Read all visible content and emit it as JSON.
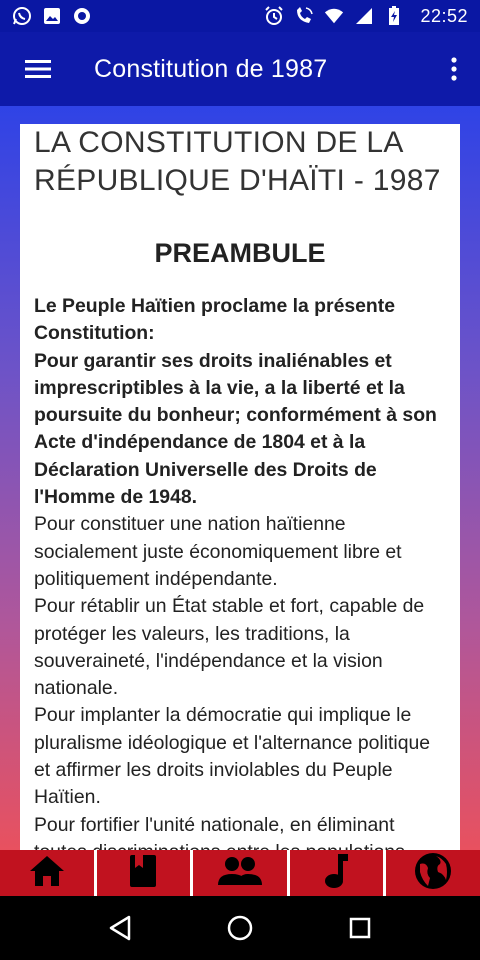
{
  "status_bar": {
    "time": "22:52",
    "left_icons": [
      "whatsapp-icon",
      "image-icon",
      "circle-app-icon"
    ],
    "right_icons": [
      "alarm-icon",
      "wifi-call-icon",
      "wifi-icon",
      "signal-icon",
      "battery-charging-icon"
    ]
  },
  "app_bar": {
    "title": "Constitution de 1987",
    "menu_icon": "hamburger-menu-icon",
    "more_icon": "more-vert-icon"
  },
  "document": {
    "title": "LA CONSTITUTION DE LA RÉPUBLIQUE D'HAÏTI - 1987",
    "heading": "PREAMBULE",
    "bold_intro": "Le Peuple Haïtien proclame la présente Constitution:",
    "bold_para": "Pour garantir ses droits inaliénables et imprescriptibles à la vie, a la liberté et la poursuite du bonheur; conformément à son Acte d'indépendance de 1804 et à la Déclaration Universelle des Droits de l'Homme de 1948.",
    "paragraphs": [
      "Pour constituer une nation haïtienne socialement juste économiquement libre et politiquement indépendante.",
      "Pour rétablir un État stable et fort, capable de protéger les valeurs, les traditions, la souveraineté, l'indépendance et la vision nationale.",
      "Pour implanter la démocratie qui implique le pluralisme idéologique et l'alternance politique et affirmer les droits inviolables du Peuple Haïtien.",
      "Pour fortifier l'unité nationale, en éliminant toutes discriminations entre les populations"
    ]
  },
  "tabs": [
    {
      "icon": "home-icon"
    },
    {
      "icon": "book-icon"
    },
    {
      "icon": "people-icon"
    },
    {
      "icon": "music-note-icon"
    },
    {
      "icon": "globe-icon"
    }
  ],
  "colors": {
    "status_bar": "#0a17a3",
    "app_bar": "#0e1aa9",
    "gradient_top": "#2f43e6",
    "gradient_bottom": "#e8515f",
    "tab_bar": "#c1121f"
  }
}
